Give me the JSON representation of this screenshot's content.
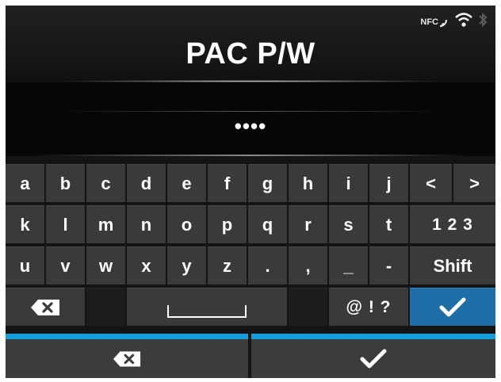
{
  "header": {
    "title": "PAC P/W",
    "status": {
      "nfc_label": "NFC"
    }
  },
  "input": {
    "value": "••••"
  },
  "keyboard": {
    "row1": [
      "a",
      "b",
      "c",
      "d",
      "e",
      "f",
      "g",
      "h",
      "i",
      "j"
    ],
    "row2": [
      "k",
      "l",
      "m",
      "n",
      "o",
      "p",
      "q",
      "r",
      "s",
      "t"
    ],
    "row3": [
      "u",
      "v",
      "w",
      "x",
      "y",
      "z",
      ".",
      ",",
      "_",
      "-"
    ],
    "prev_label": "<",
    "next_label": ">",
    "numbers_label": "1 2 3",
    "shift_label": "Shift",
    "symbols_label": "@ ! ?"
  },
  "colors": {
    "accent": "#1e6ea8",
    "bar_accent": "#12a0dc",
    "key": "#3a3a3a",
    "background": "#141414"
  }
}
